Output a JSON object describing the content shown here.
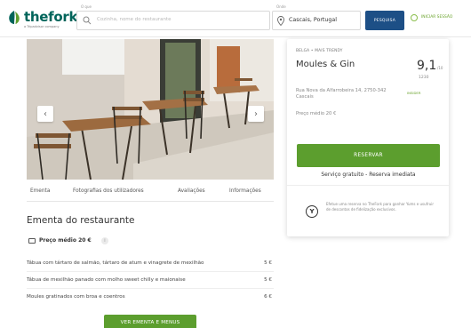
{
  "header": {
    "logo_text": "thefork",
    "logo_sub": "a Tripadvisor company",
    "search_caption": "O que",
    "search_placeholder": "Cozinha, nome do restaurante",
    "location_caption": "Onde",
    "location_value": "Cascais, Portugal",
    "search_button": "PESQUISA",
    "yums_link": "INICIAR SESSÃO"
  },
  "gallery": {
    "prev_label": "‹",
    "next_label": "›"
  },
  "tabs": [
    {
      "label": "Ementa"
    },
    {
      "label": "Fotografias dos utilizadores"
    },
    {
      "label": "Avaliações"
    },
    {
      "label": "Informações"
    }
  ],
  "menu": {
    "title": "Ementa do restaurante",
    "avg_price": "Preço médio 20 €",
    "info_glyph": "i",
    "dishes": [
      {
        "name": "Tábua com tártaro de salmão, tártaro de atum e vinagrete de mexilhão",
        "price": "5 €"
      },
      {
        "name": "Tábua de mexilhão panado com molho sweet chilly e maionaise",
        "price": "5 €"
      },
      {
        "name": "Moules gratinados com broa e coentros",
        "price": "6 €"
      }
    ],
    "button": "VER EMENTA E MENUS"
  },
  "restaurant": {
    "breadcrumb": "BELGA • MAIS TRENDY",
    "name": "Moules & Gin",
    "rating": "9,1",
    "rating_scale": "/10",
    "reviews": "1230",
    "address": "Rua Nova da Alfarrobeira 14, 2750-342 Cascais",
    "address_tag": "INSIDER",
    "avg_price": "Preço médio 20 €",
    "reserve_button": "RESERVAR",
    "free_service": "Serviço gratuito - Reserva imediata",
    "yums_glyph": "Y",
    "yums_note": "Efetue uma reserva no TheFork para ganhar Yums e usufruir de descontos de fidelização exclusivos."
  },
  "colors": {
    "brand_green": "#00645a",
    "button_green": "#5c9e2e",
    "search_blue": "#1d4f86"
  },
  "icons": {
    "logo": "thefork-leaf-icon",
    "search": "search-icon",
    "location": "location-pin-icon",
    "price": "wallet-icon",
    "yums": "yums-coin-icon"
  }
}
